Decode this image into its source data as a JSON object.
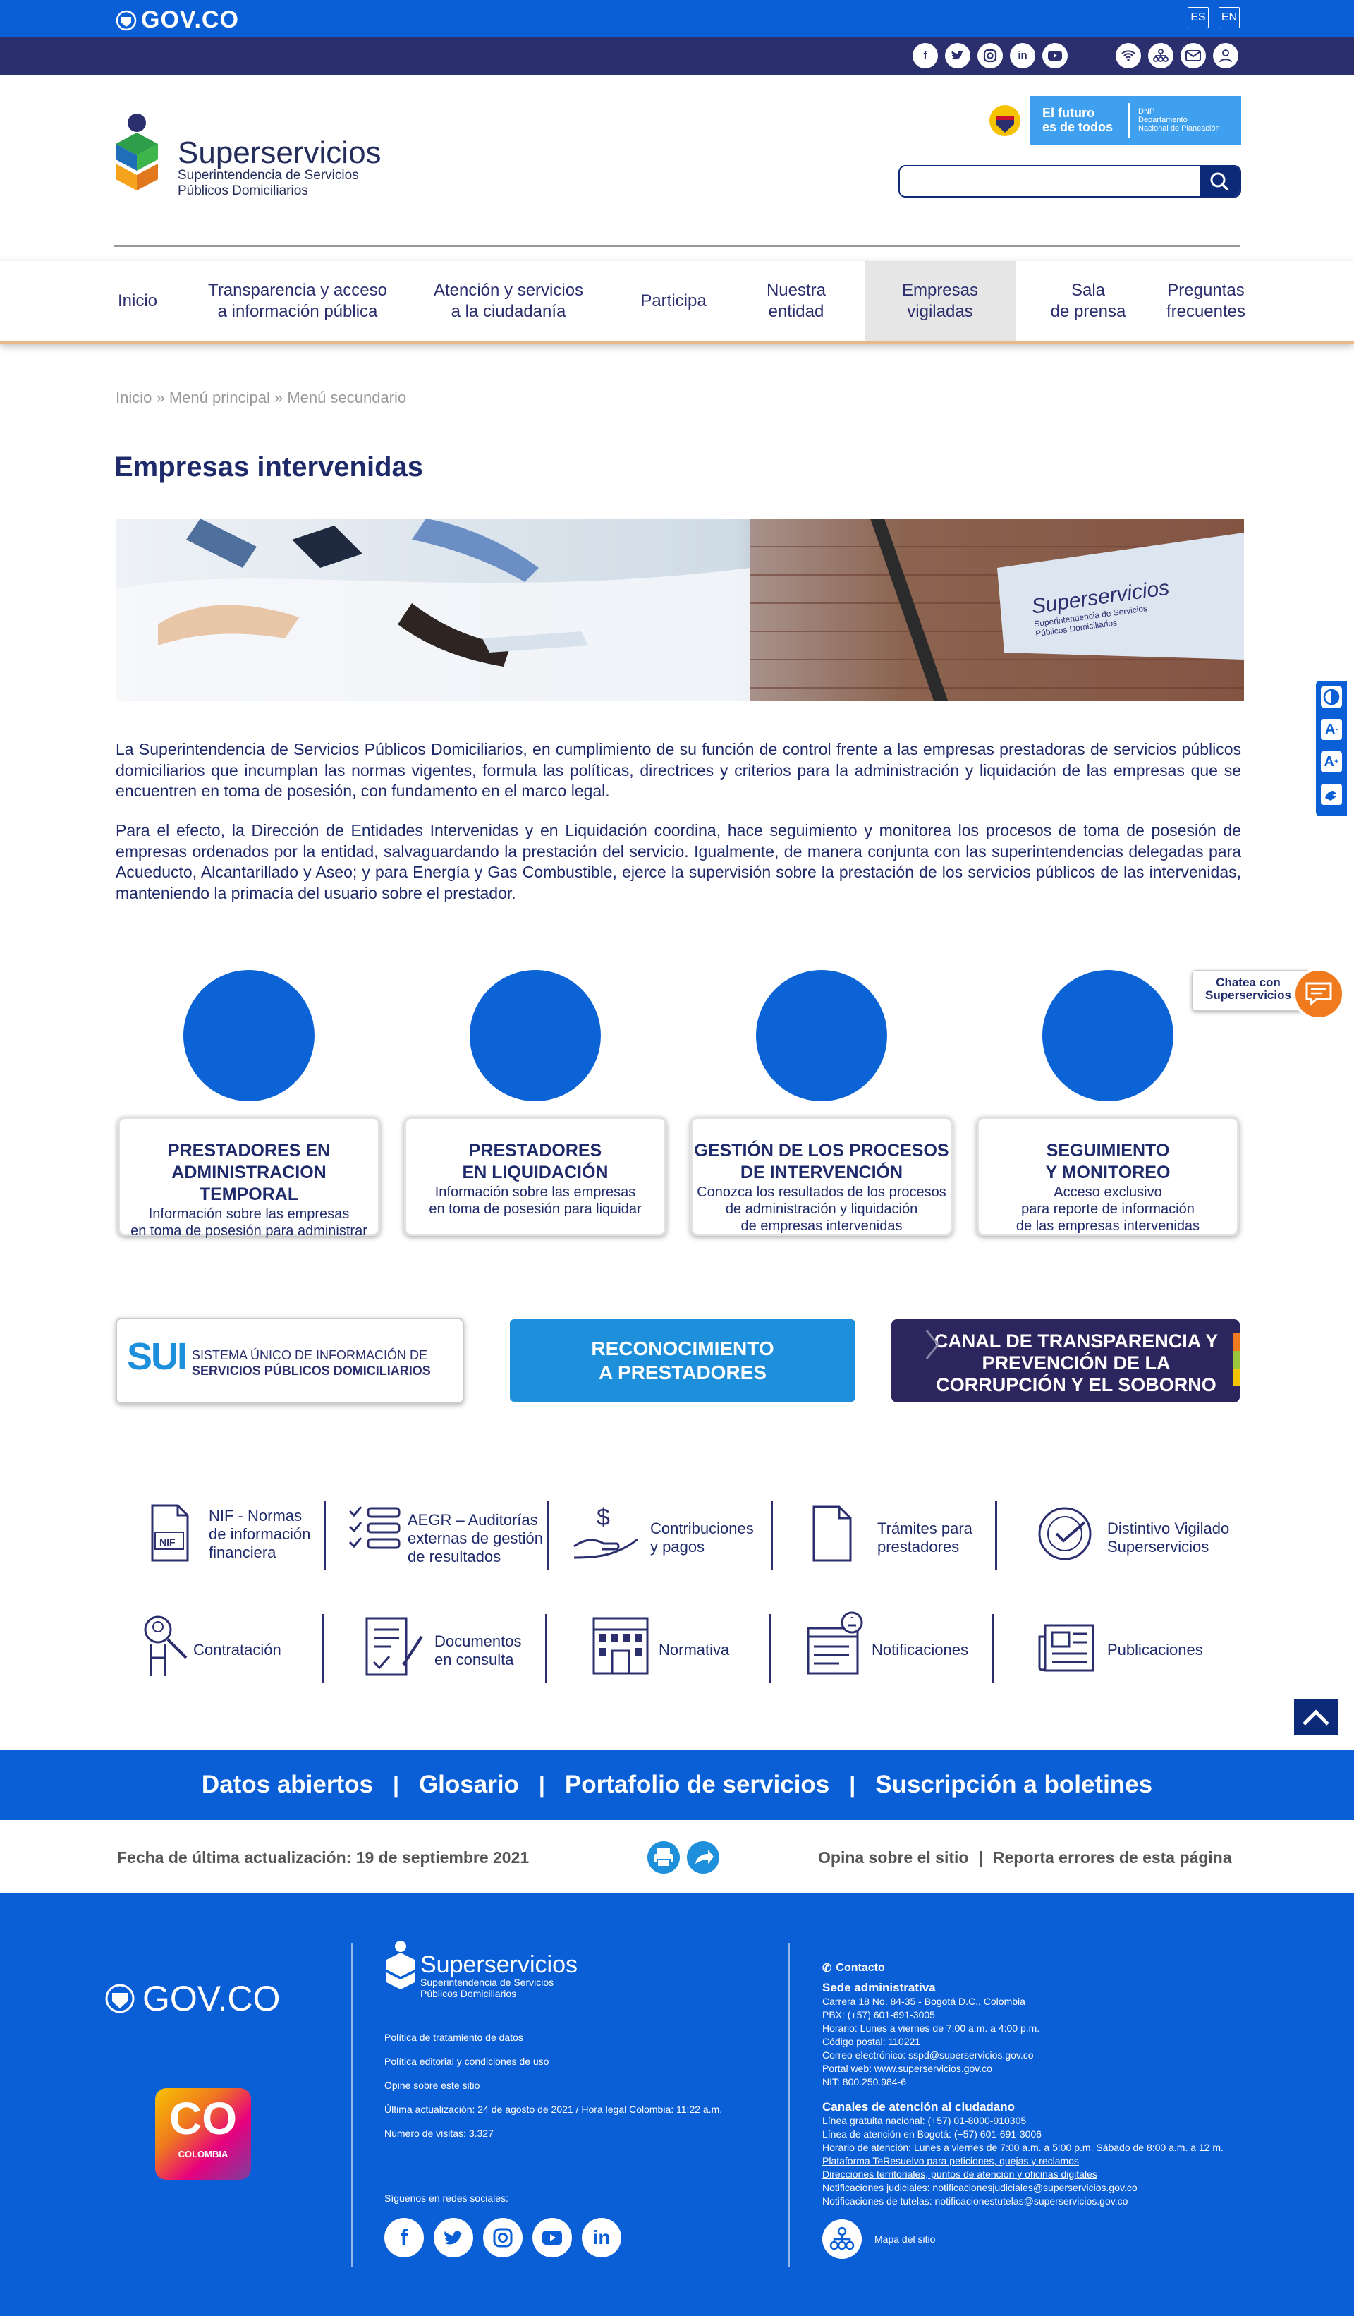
{
  "gov_bar": {
    "logo": "GOV.CO",
    "lang_es": "ES",
    "lang_en": "EN"
  },
  "social_top": [
    "f",
    "t",
    "ig",
    "in",
    "yt"
  ],
  "access_icons": [
    "wifi-icon",
    "sitemap-icon",
    "mail-icon",
    "people-icon"
  ],
  "header": {
    "org_name": "Superservicios",
    "org_sub1": "Superintendencia de Servicios",
    "org_sub2": "Públicos Domiciliarios",
    "dnp_line1": "El futuro",
    "dnp_line2": "es de todos",
    "dnp_right1": "DNP",
    "dnp_right2": "Departamento",
    "dnp_right3": "Nacional de Planeación",
    "search_placeholder": ""
  },
  "nav": {
    "items": [
      {
        "l1": "Inicio",
        "l2": ""
      },
      {
        "l1": "Transparencia y acceso",
        "l2": "a información pública"
      },
      {
        "l1": "Atención y servicios",
        "l2": "a la ciudadanía"
      },
      {
        "l1": "Participa",
        "l2": ""
      },
      {
        "l1": "Nuestra",
        "l2": "entidad"
      },
      {
        "l1": "Empresas",
        "l2": "vigiladas"
      },
      {
        "l1": "Sala",
        "l2": "de prensa"
      },
      {
        "l1": "Preguntas",
        "l2": "frecuentes"
      }
    ]
  },
  "breadcrumb": "Inicio » Menú principal » Menú secundario",
  "page_title": "Empresas intervenidas",
  "banner": {
    "logo_text": "Superservicios",
    "logo_sub1": "Superintendencia de Servicios",
    "logo_sub2": "Públicos Domiciliarios"
  },
  "paragraphs": [
    "La Superintendencia de Servicios Públicos Domiciliarios, en cumplimiento de su función de control frente a las empresas prestadoras de servicios públicos domiciliarios que incumplan las normas vigentes, formula las políticas, directrices y criterios para la administración y liquidación de las empresas que se encuentren en toma de posesión, con fundamento en el marco legal.",
    "Para el efecto, la Dirección de Entidades Intervenidas y en Liquidación coordina, hace seguimiento y monitorea los procesos de toma de posesión de empresas ordenados por la entidad, salvaguardando la prestación del servicio. Igualmente, de manera conjunta con las superintendencias delegadas para Acueducto, Alcantarillado y Aseo; y para Energía y Gas Combustible, ejerce la supervisión sobre la prestación de los servicios públicos de las intervenidas, manteniendo la primacía del usuario sobre el prestador."
  ],
  "cards": [
    {
      "t1": "PRESTADORES EN",
      "t2": "ADMINISTRACION TEMPORAL",
      "d1": "Información sobre las empresas",
      "d2": "en toma de posesión para administrar",
      "d3": ""
    },
    {
      "t1": "PRESTADORES",
      "t2": "EN LIQUIDACIÓN",
      "d1": "Información sobre las empresas",
      "d2": "en toma de posesión para liquidar",
      "d3": ""
    },
    {
      "t1": "GESTIÓN DE LOS PROCESOS",
      "t2": "DE INTERVENCIÓN",
      "d1": "Conozca los resultados de los procesos",
      "d2": "de administración y liquidación",
      "d3": "de empresas intervenidas"
    },
    {
      "t1": "SEGUIMIENTO",
      "t2": "Y MONITOREO",
      "d1": "Acceso exclusivo",
      "d2": "para reporte de información",
      "d3": "de las empresas intervenidas"
    }
  ],
  "promo": {
    "sui_logo": "SUI",
    "sui_l1": "SISTEMA ÚNICO DE INFORMACIÓN DE",
    "sui_l2": "SERVICIOS PÚBLICOS DOMICILIARIOS",
    "rec_l1": "RECONOCIMIENTO",
    "rec_l2": "A PRESTADORES",
    "can_l1": "CANAL DE TRANSPARENCIA Y",
    "can_l2": "PREVENCIÓN DE LA",
    "can_l3": "CORRUPCIÓN Y EL SOBORNO"
  },
  "links_row1": [
    {
      "icon": "nif-document-icon",
      "badge": "NIF",
      "text": [
        "NIF - Normas",
        "de información",
        "financiera"
      ]
    },
    {
      "icon": "checklist-icon",
      "text": [
        "AEGR – Auditorías",
        "externas de gestión",
        "de resultados"
      ]
    },
    {
      "icon": "hand-money-icon",
      "text": [
        "Contribuciones",
        "y pagos"
      ]
    },
    {
      "icon": "document-icon",
      "text": [
        "Trámites para",
        "prestadores"
      ]
    },
    {
      "icon": "seal-icon",
      "text": [
        "Distintivo Vigilado",
        "Superservicios"
      ]
    }
  ],
  "links_row2": [
    {
      "icon": "person-search-icon",
      "text": [
        "Contratación"
      ]
    },
    {
      "icon": "signed-document-icon",
      "text": [
        "Documentos",
        "en consulta"
      ]
    },
    {
      "icon": "building-icon",
      "text": [
        "Normativa"
      ]
    },
    {
      "icon": "bell-window-icon",
      "text": [
        "Notificaciones"
      ]
    },
    {
      "icon": "newspaper-icon",
      "text": [
        "Publicaciones"
      ]
    }
  ],
  "blue_links": [
    "Datos abiertos",
    "Glosario",
    "Portafolio de servicios",
    "Suscripción a boletines"
  ],
  "update_bar": {
    "date": "Fecha de última actualización: 19 de septiembre 2021",
    "opina": "Opina sobre el sitio",
    "reporta": "Reporta errores de esta página",
    "sep": "|"
  },
  "footer": {
    "gov": "GOV.CO",
    "co_big": "CO",
    "co_small": "COLOMBIA",
    "org_name": "Superservicios",
    "org_sub1": "Superintendencia de Servicios",
    "org_sub2": "Públicos Domiciliarios",
    "links": [
      "Política de tratamiento de datos",
      "Política editorial y condiciones de uso",
      "Opine sobre este sitio",
      "Última actualización: 24 de agosto de 2021 / Hora legal Colombia: 11:22 a.m.",
      "Número de visitas: 3.327"
    ],
    "follow": "Síguenos en redes sociales:",
    "contact_title": "Contacto",
    "sede_title": "Sede administrativa",
    "sede_lines": [
      "Carrera 18 No. 84-35 - Bogotá D.C., Colombia",
      "PBX: (+57) 601-691-3005",
      "Horario: Lunes a viernes de 7:00 a.m. a 4:00 p.m.",
      "Código postal: 110221",
      "Correo electrónico: sspd@superservicios.gov.co",
      "Portal web: www.superservicios.gov.co",
      "NIT: 800.250.984-6"
    ],
    "canales_title": "Canales de atención al ciudadano",
    "canales_lines": [
      "Línea gratuita nacional: (+57) 01-8000-910305",
      "Línea de atención en Bogotá: (+57) 601-691-3006",
      "Horario de atención: Lunes a viernes de 7:00 a.m. a 5:00 p.m. Sábado de 8:00 a.m. a 12 m.",
      "Plataforma TeResuelvo para peticiones, quejas y reclamos",
      "Direcciones territoriales, puntos de atención y oficinas digitales",
      "Notificaciones judiciales: notificacionesjudiciales@superservicios.gov.co",
      "Notificaciones de tutelas: notificacionestutelas@superservicios.gov.co"
    ],
    "sitemap": "Mapa del sitio"
  },
  "chat": {
    "l1": "Chatea con",
    "l2": "Superservicios"
  },
  "colors": {
    "gov_blue": "#0B5FD6",
    "navy": "#2B2F6E",
    "orange": "#F07A1E"
  }
}
